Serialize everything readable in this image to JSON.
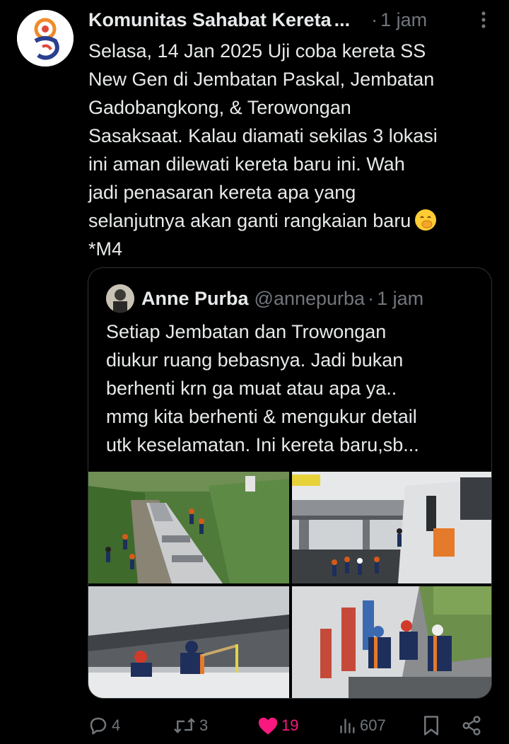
{
  "post": {
    "author": "Komunitas Sahabat Kereta",
    "author_ellipsis": "...",
    "dot": "·",
    "time": "1 jam",
    "text_lines": [
      "Selasa, 14 Jan 2025 Uji coba kereta SS",
      "New Gen di Jembatan Paskal, Jembatan",
      "Gadobangkong, & Terowongan",
      "Sasaksaat. Kalau diamati sekilas 3 lokasi",
      "ini aman dilewati kereta baru ini. Wah",
      "jadi penasaran kereta apa yang",
      "selanjutnya akan ganti rangkaian baru",
      "*M4"
    ],
    "emoji": "hand-over-mouth-emoji"
  },
  "quote": {
    "name": "Anne Purba",
    "handle": "@annepurba",
    "dot": "·",
    "time": "1 jam",
    "text_lines": [
      "Setiap Jembatan dan Trowongan",
      "diukur ruang bebasnya. Jadi bukan",
      "berhenti krn ga muat atau apa ya..",
      "mmg kita berhenti & mengukur detail",
      "utk keselamatan. Ini kereta baru,sb..."
    ],
    "photos": [
      "train-on-track-photo",
      "train-under-bridge-photo",
      "workers-measuring-photo",
      "workers-on-train-roof-photo"
    ]
  },
  "actions": {
    "replies": "4",
    "reposts": "3",
    "likes": "19",
    "views": "607"
  },
  "colors": {
    "background": "#000000",
    "text": "#e7e9ea",
    "muted": "#71767b",
    "like": "#f91880",
    "border": "#2f3336"
  }
}
